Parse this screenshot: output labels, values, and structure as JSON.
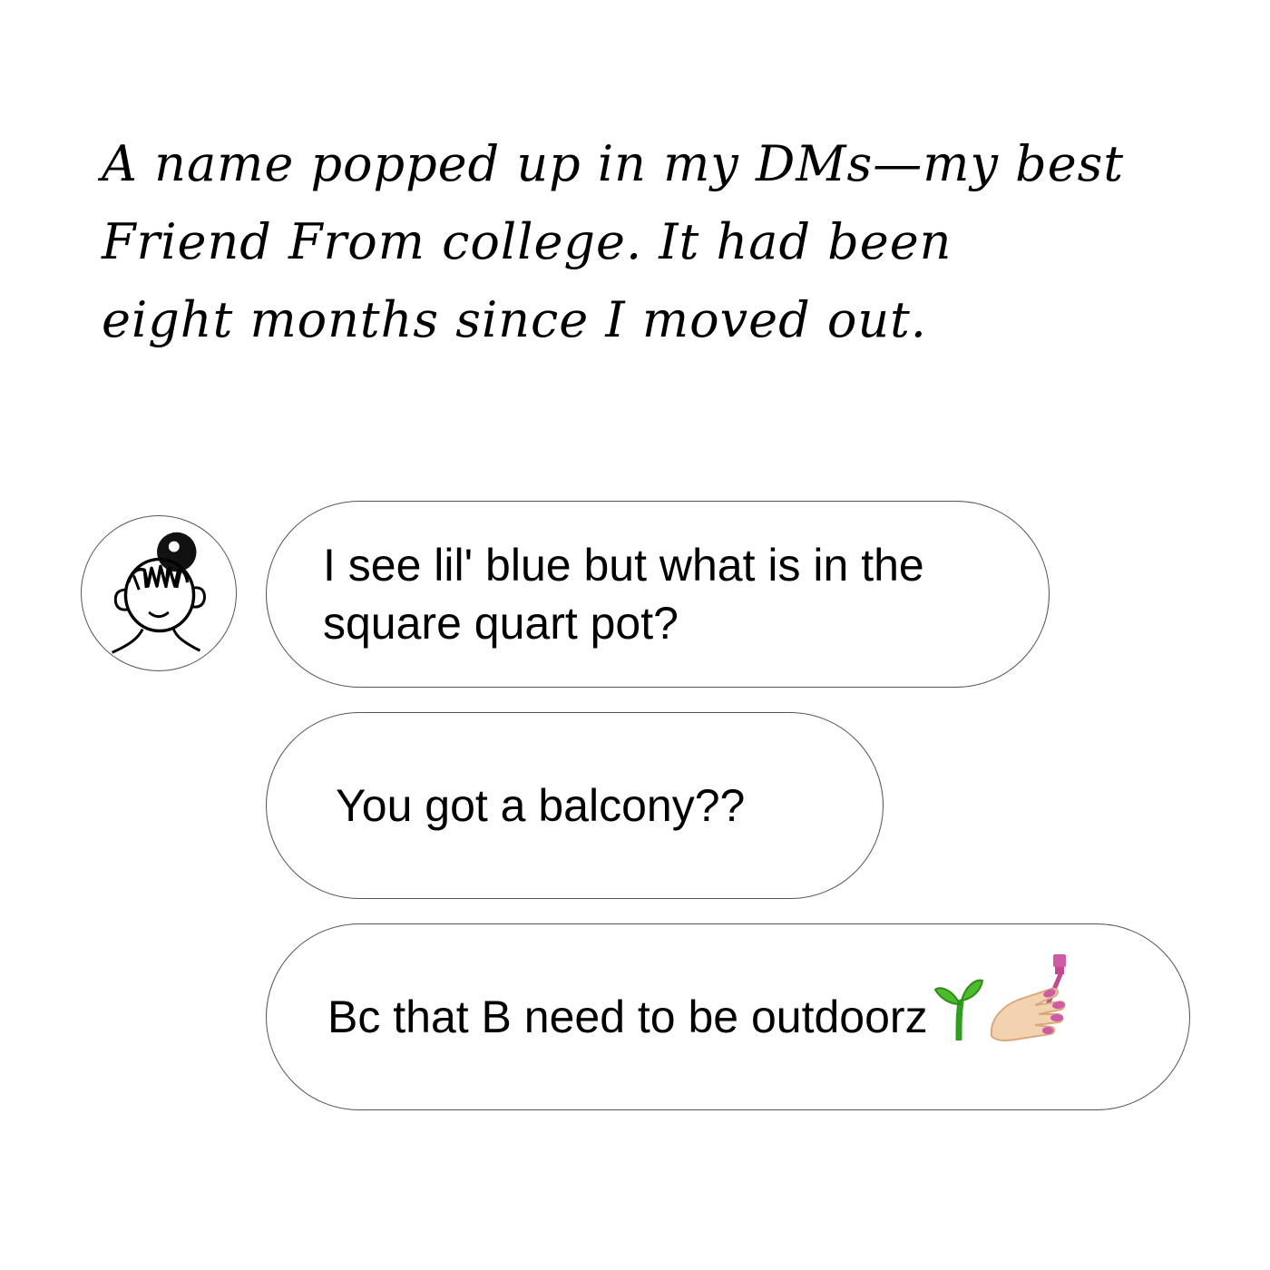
{
  "narration": {
    "lines": [
      "A name popped up in my DMs—my best",
      "Friend From college. It had been",
      "eight months since I moved out."
    ]
  },
  "avatar": {
    "icon": "doodle-girl-with-hair-bun"
  },
  "messages": [
    {
      "text": " I see lil' blue but what is in the\nsquare quart pot?"
    },
    {
      "text": "You got a balcony??"
    },
    {
      "text": "Bc that B need to be outdoorz",
      "emoji": [
        "seedling-icon",
        "nail-polish-icon"
      ]
    }
  ],
  "colors": {
    "bubble_border": "#555555",
    "sprout": "#2f9e1f",
    "nail_polish": "#d05aa6",
    "skin": "#f3d2b0"
  }
}
